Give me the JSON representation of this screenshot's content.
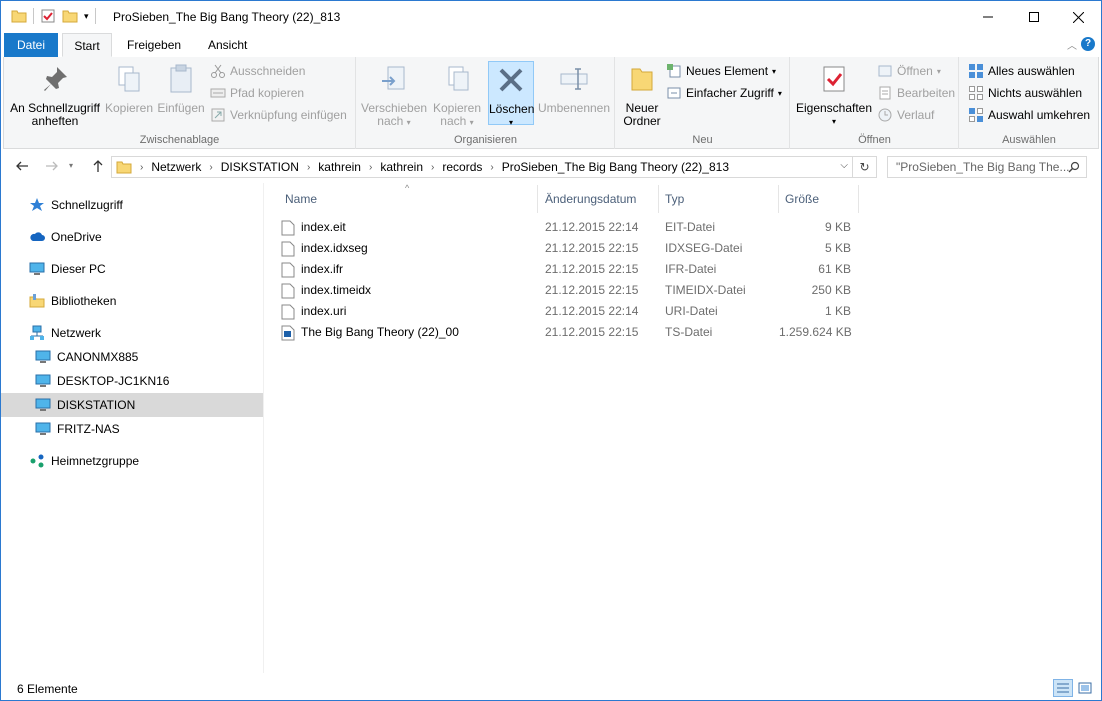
{
  "window": {
    "title": "ProSieben_The Big Bang Theory (22)_813",
    "minimize": "—",
    "maximize": "☐",
    "close": "✕"
  },
  "ribbon_tabs": {
    "file": "Datei",
    "start": "Start",
    "share": "Freigeben",
    "view": "Ansicht"
  },
  "ribbon": {
    "clipboard": {
      "label": "Zwischenablage",
      "pin_line1": "An Schnellzugriff",
      "pin_line2": "anheften",
      "copy": "Kopieren",
      "paste": "Einfügen",
      "cut": "Ausschneiden",
      "copy_path": "Pfad kopieren",
      "paste_shortcut": "Verknüpfung einfügen"
    },
    "organize": {
      "label": "Organisieren",
      "move_line1": "Verschieben",
      "move_line2": "nach",
      "copyto_line1": "Kopieren",
      "copyto_line2": "nach",
      "delete": "Löschen",
      "rename": "Umbenennen"
    },
    "new": {
      "label": "Neu",
      "new_folder_line1": "Neuer",
      "new_folder_line2": "Ordner",
      "new_item": "Neues Element",
      "easy_access": "Einfacher Zugriff"
    },
    "open": {
      "label": "Öffnen",
      "properties": "Eigenschaften",
      "open": "Öffnen",
      "edit": "Bearbeiten",
      "history": "Verlauf"
    },
    "select": {
      "label": "Auswählen",
      "select_all": "Alles auswählen",
      "select_none": "Nichts auswählen",
      "invert": "Auswahl umkehren"
    }
  },
  "address": {
    "crumbs": [
      "Netzwerk",
      "DISKSTATION",
      "kathrein",
      "kathrein",
      "records",
      "ProSieben_The Big Bang Theory (22)_813"
    ],
    "search_placeholder": "\"ProSieben_The Big Bang The..."
  },
  "nav": {
    "quick_access": "Schnellzugriff",
    "onedrive": "OneDrive",
    "this_pc": "Dieser PC",
    "libraries": "Bibliotheken",
    "network": "Netzwerk",
    "network_items": [
      "CANONMX885",
      "DESKTOP-JC1KN16",
      "DISKSTATION",
      "FRITZ-NAS"
    ],
    "homegroup": "Heimnetzgruppe"
  },
  "columns": {
    "name": "Name",
    "date": "Änderungsdatum",
    "type": "Typ",
    "size": "Größe"
  },
  "files": [
    {
      "name": "index.eit",
      "date": "21.12.2015 22:14",
      "type": "EIT-Datei",
      "size": "9 KB"
    },
    {
      "name": "index.idxseg",
      "date": "21.12.2015 22:15",
      "type": "IDXSEG-Datei",
      "size": "5 KB"
    },
    {
      "name": "index.ifr",
      "date": "21.12.2015 22:15",
      "type": "IFR-Datei",
      "size": "61 KB"
    },
    {
      "name": "index.timeidx",
      "date": "21.12.2015 22:15",
      "type": "TIMEIDX-Datei",
      "size": "250 KB"
    },
    {
      "name": "index.uri",
      "date": "21.12.2015 22:14",
      "type": "URI-Datei",
      "size": "1 KB"
    },
    {
      "name": "The Big Bang Theory (22)_00",
      "date": "21.12.2015 22:15",
      "type": "TS-Datei",
      "size": "1.259.624 KB"
    }
  ],
  "status": {
    "count": "6 Elemente"
  },
  "colors": {
    "accent": "#1979ca",
    "selected_nav": "#d9d9d9",
    "folder": "#f8d775"
  }
}
